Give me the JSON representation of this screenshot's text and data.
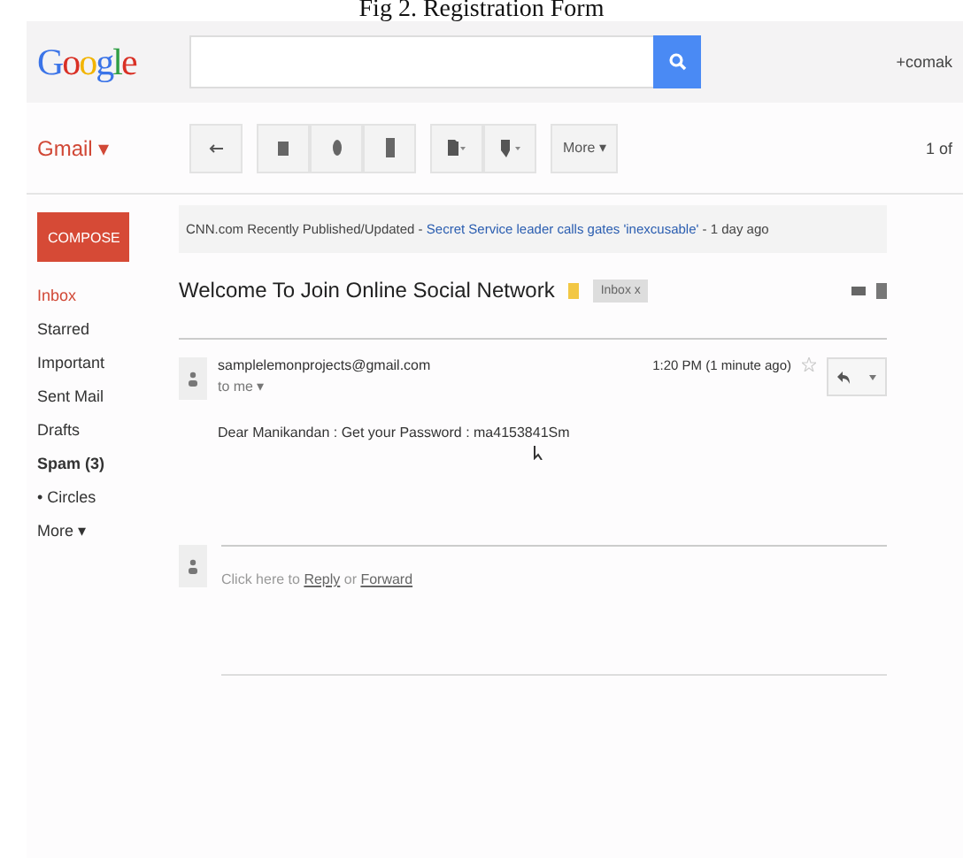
{
  "caption": "Fig 2. Registration Form",
  "header": {
    "logo": "Google",
    "user": "+comak"
  },
  "toolbar": {
    "app_menu": "Gmail ▾",
    "more": "More ▾",
    "pager": "1 of"
  },
  "compose": "COMPOSE",
  "sidebar": {
    "items": [
      {
        "label": "Inbox",
        "selected": true,
        "bold": false
      },
      {
        "label": "Starred",
        "selected": false,
        "bold": false
      },
      {
        "label": "Important",
        "selected": false,
        "bold": false
      },
      {
        "label": "Sent Mail",
        "selected": false,
        "bold": false
      },
      {
        "label": "Drafts",
        "selected": false,
        "bold": false
      },
      {
        "label": "Spam (3)",
        "selected": false,
        "bold": true
      },
      {
        "label": "• Circles",
        "selected": false,
        "bold": false
      },
      {
        "label": "More ▾",
        "selected": false,
        "bold": false
      }
    ]
  },
  "ad": {
    "source": "CNN.com Recently Published/Updated - ",
    "link": "Secret Service leader calls gates 'inexcusable'",
    "age": " - 1 day ago"
  },
  "message": {
    "subject": "Welcome To Join Online Social Network",
    "tag": "Inbox",
    "tag_close": "x",
    "from": "samplelemonprojects@gmail.com",
    "to": "to me ▾",
    "time": "1:20 PM (1 minute ago)",
    "body": "Dear Manikandan  :  Get your Password : ma4153841Sm"
  },
  "reply": {
    "before": "Click here to ",
    "reply": "Reply",
    "middle": " or ",
    "forward": "Forward"
  }
}
